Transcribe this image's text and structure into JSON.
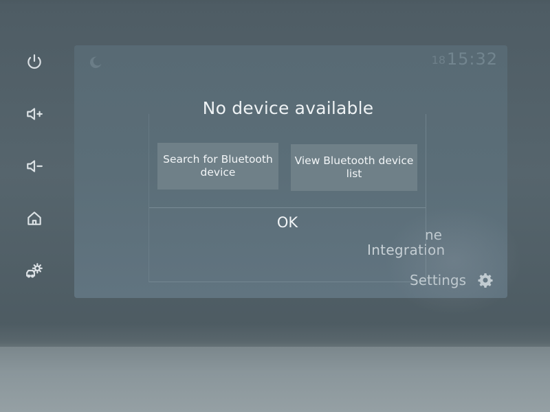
{
  "side_buttons": [
    {
      "icon": "power-icon"
    },
    {
      "icon": "volume-up-icon"
    },
    {
      "icon": "volume-down-icon"
    },
    {
      "icon": "home-icon"
    },
    {
      "icon": "car-settings-icon"
    }
  ],
  "status_bar": {
    "temperature": "18",
    "time": "15:32",
    "mode_icon": "moon-icon"
  },
  "background": {
    "partial_label": "ne",
    "integration_label": "Integration",
    "settings_label": "Settings",
    "settings_icon": "gear-icon"
  },
  "dialog": {
    "title": "No device available",
    "search_button": "Search for Bluetooth device",
    "view_list_button": "View Bluetooth device list",
    "ok_button": "OK"
  },
  "colors": {
    "screen_bg": "#5b6e78",
    "dialog_button_bg": "#6f8088",
    "text": "#eef2f4"
  }
}
